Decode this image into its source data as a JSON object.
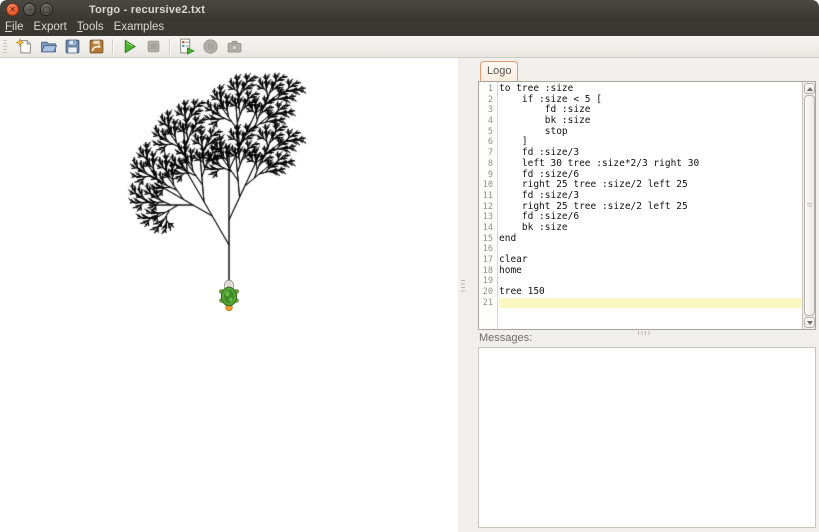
{
  "window": {
    "title": "Torgo - recursive2.txt",
    "controls": {
      "close_glyph": "✕",
      "minimize_glyph": "–",
      "maximize_glyph": "▢"
    }
  },
  "menu": {
    "items": [
      {
        "pre": "",
        "mn": "F",
        "post": "ile"
      },
      {
        "pre": "Export",
        "mn": "",
        "post": ""
      },
      {
        "pre": "",
        "mn": "T",
        "post": "ools"
      },
      {
        "pre": "Examples",
        "mn": "",
        "post": ""
      }
    ]
  },
  "toolbar": {
    "buttons": [
      {
        "name": "new-file",
        "icon": "new-file-icon",
        "enabled": true
      },
      {
        "name": "open-file",
        "icon": "open-folder-icon",
        "enabled": true
      },
      {
        "name": "save-file",
        "icon": "save-floppy-icon",
        "enabled": true
      },
      {
        "name": "export",
        "icon": "export-floppy-arrow-icon",
        "enabled": true
      },
      {
        "name": "run",
        "icon": "run-play-icon",
        "enabled": true
      },
      {
        "name": "stop",
        "icon": "stop-square-icon",
        "enabled": false
      },
      {
        "name": "trace",
        "icon": "trace-script-play-icon",
        "enabled": true
      },
      {
        "name": "pause",
        "icon": "pause-circle-icon",
        "enabled": false
      },
      {
        "name": "screenshot",
        "icon": "camera-icon",
        "enabled": false
      }
    ]
  },
  "editor": {
    "tab_label": "Logo",
    "active_line": 21,
    "lines": [
      "to tree :size",
      "    if :size < 5 [",
      "        fd :size",
      "        bk :size",
      "        stop",
      "    ]",
      "    fd :size/3",
      "    left 30 tree :size*2/3 right 30",
      "    fd :size/6",
      "    right 25 tree :size/2 left 25",
      "    fd :size/3",
      "    right 25 tree :size/2 left 25",
      "    fd :size/6",
      "    bk :size",
      "end",
      "",
      "clear",
      "home",
      "",
      "tree 150",
      ""
    ]
  },
  "messages": {
    "label": "Messages:",
    "content": ""
  },
  "turtle_canvas": {
    "background": "#ffffff",
    "pen_color": "#000000",
    "turtle_sprite": "green-turtle-facing-up",
    "program": {
      "command": "tree 150",
      "size": 150,
      "min_size": 5,
      "left_branch_angle": 30,
      "left_branch_scale": 0.6666666666666666,
      "right_branch_angle": 25,
      "right_branch_scale": 0.5
    }
  },
  "colors": {
    "titlebar_bg": "#3a3833",
    "close_button": "#dd4814",
    "run_green": "#3da62b",
    "tab_border": "#e29b72",
    "active_line_highlight": "#faf7c3",
    "panel_bg": "#f1efeb"
  }
}
